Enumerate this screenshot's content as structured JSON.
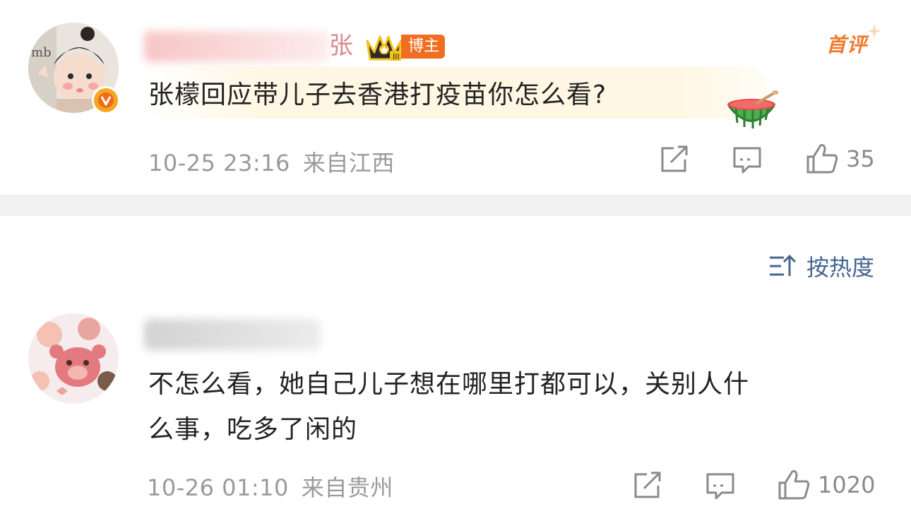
{
  "colors": {
    "accent": "#ef6e1f",
    "sort_blue": "#44668e",
    "meta_gray": "#9a9a9a",
    "vip": "#f5a623"
  },
  "post": {
    "author_tail": "张",
    "badge_label": "博主",
    "first_badge": "首评",
    "content": "张檬回应带儿子去香港打疫苗你怎么看?",
    "time": "10-25 23:16",
    "source": "来自江西",
    "like_count": "35",
    "icons": [
      "crown-icon",
      "watermelon-sticker",
      "share-icon",
      "comment-icon",
      "like-icon",
      "vip-badge-icon"
    ]
  },
  "sort": {
    "label": "按热度",
    "icon": "sort-icon"
  },
  "comment": {
    "content_line1": "不怎么看，她自己儿子想在哪里打都可以，关别人什",
    "content_line2": "么事，吃多了闲的",
    "time": "10-26 01:10",
    "source": "来自贵州",
    "like_count": "1020",
    "icons": [
      "share-icon",
      "comment-icon",
      "like-icon"
    ]
  }
}
